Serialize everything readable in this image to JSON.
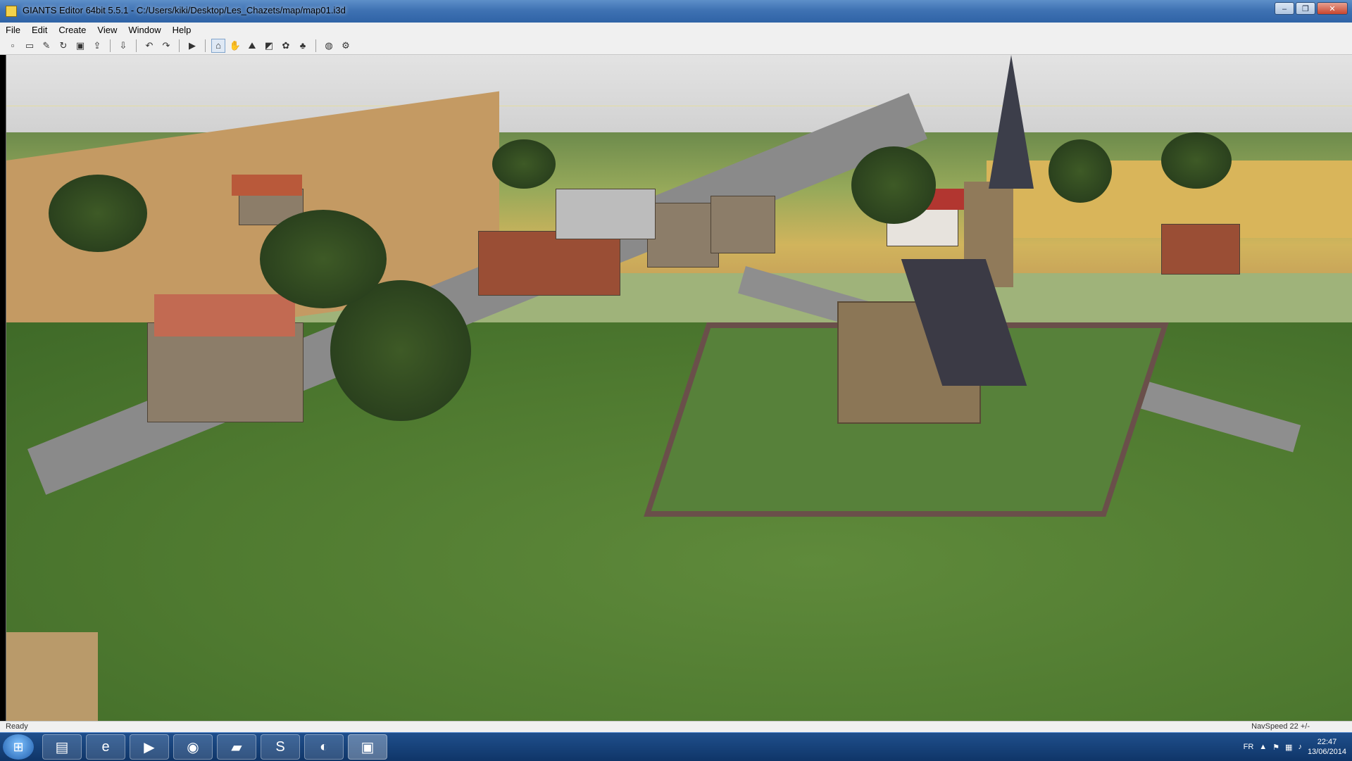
{
  "window": {
    "title": "GIANTS Editor 64bit 5.5.1 - C:/Users/kiki/Desktop/Les_Chazets/map/map01.i3d",
    "controls": {
      "minimize": "–",
      "maximize": "❐",
      "close": "✕"
    }
  },
  "menu": {
    "items": [
      "File",
      "Edit",
      "Create",
      "View",
      "Window",
      "Help"
    ]
  },
  "toolbar": {
    "icons": [
      "new-icon",
      "open-icon",
      "edit-icon",
      "refresh-icon",
      "save-icon",
      "export-icon",
      "import-icon",
      "undo-icon",
      "redo-icon",
      "play-icon",
      "select-icon",
      "hand-icon",
      "terrain-icon",
      "paint-icon",
      "foliage-icon",
      "tree-icon",
      "world-icon",
      "settings-icon"
    ]
  },
  "status": {
    "left": "Ready",
    "right": "NavSpeed 22 +/-"
  },
  "taskbar": {
    "apps": [
      "explorer-icon",
      "ie-icon",
      "media-icon",
      "chrome-icon",
      "folder-icon",
      "skype-icon",
      "firefox-icon",
      "giants-icon"
    ],
    "tray": {
      "lang": "FR",
      "time": "22:47",
      "date": "13/06/2014"
    }
  },
  "colors": {
    "titlebar": "#3f72b3",
    "sky": "#d8d8d8",
    "grass": "#4f7a30",
    "road": "#8a8a8a"
  }
}
